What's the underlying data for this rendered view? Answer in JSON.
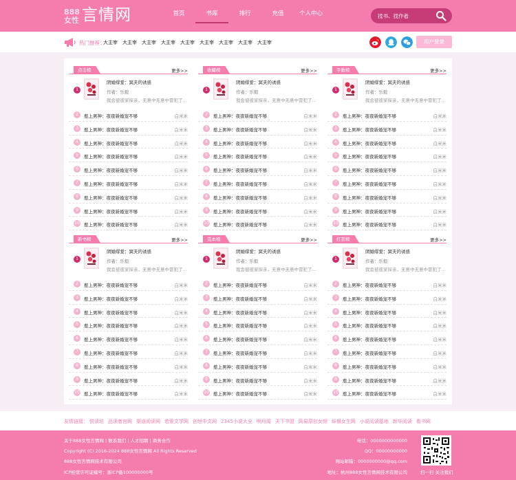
{
  "logo": {
    "num": "888",
    "small": "女性",
    "big": "言情网"
  },
  "nav": [
    "首页",
    "书库",
    "排行",
    "充值",
    "个人中心"
  ],
  "search": {
    "placeholder": "找书、找作者"
  },
  "hot": {
    "label": "热门推荐：",
    "items": [
      "大主宰",
      "大主宰",
      "大主宰",
      "大主宰",
      "大主宰",
      "大主宰",
      "大主宰",
      "大主宰",
      "大主宰"
    ]
  },
  "login_label": "用户登录",
  "panels": [
    {
      "title": "点击榜",
      "more": "更多>>"
    },
    {
      "title": "收藏榜",
      "more": "更多>>"
    },
    {
      "title": "字数榜",
      "more": "更多>>"
    },
    {
      "title": "新书榜",
      "more": "更多>>"
    },
    {
      "title": "完本榜",
      "more": "更多>>"
    },
    {
      "title": "打赏榜",
      "more": "更多>>"
    }
  ],
  "top_book": {
    "rank": "1",
    "title": "阴婚缪爱：冥夫的诱惑",
    "author": "作者：乐毅",
    "desc": "我会彼彼家探亲，无意中无意中冒犯了..."
  },
  "list_book": {
    "title": "惹上男神：夜夜新婚宠不够",
    "author": "白米米"
  },
  "list_ranks": [
    "2",
    "3",
    "4",
    "5",
    "6",
    "7",
    "8",
    "9",
    "10"
  ],
  "friend": {
    "label": "友情链接：",
    "links": [
      "悦读坊",
      "品读者官网",
      "渠道阅读网",
      "若爱文学网",
      "创世中文网",
      "2345小说大全",
      "明月阁",
      "天下书盟",
      "网易原创女频",
      "纵横女生网",
      "小说阅读基地",
      "新华阅读",
      "看书网"
    ]
  },
  "footer": {
    "links": "关于888女性言情网 | 联系我们 | 人才招聘 | 商务合作",
    "copyright": "Copyright (C) 2016-2024 888女性言情网 All Rights Reserved",
    "company": "888女性言情网技术有限公司",
    "icp": "ICP经营许可证编号：浙ICP备100000000号",
    "phone": "电话：0000000000000",
    "qq": "QQ：00000000000",
    "email": "网站邮箱：0000000000@qq.com",
    "address": "地址：杭州888女性言情网技术有限公司",
    "qr_label": "扫一扫 关注我们"
  },
  "colors": {
    "brand": "#f57dae",
    "accent": "#c63c77",
    "rank_top": "#d12c6d"
  }
}
